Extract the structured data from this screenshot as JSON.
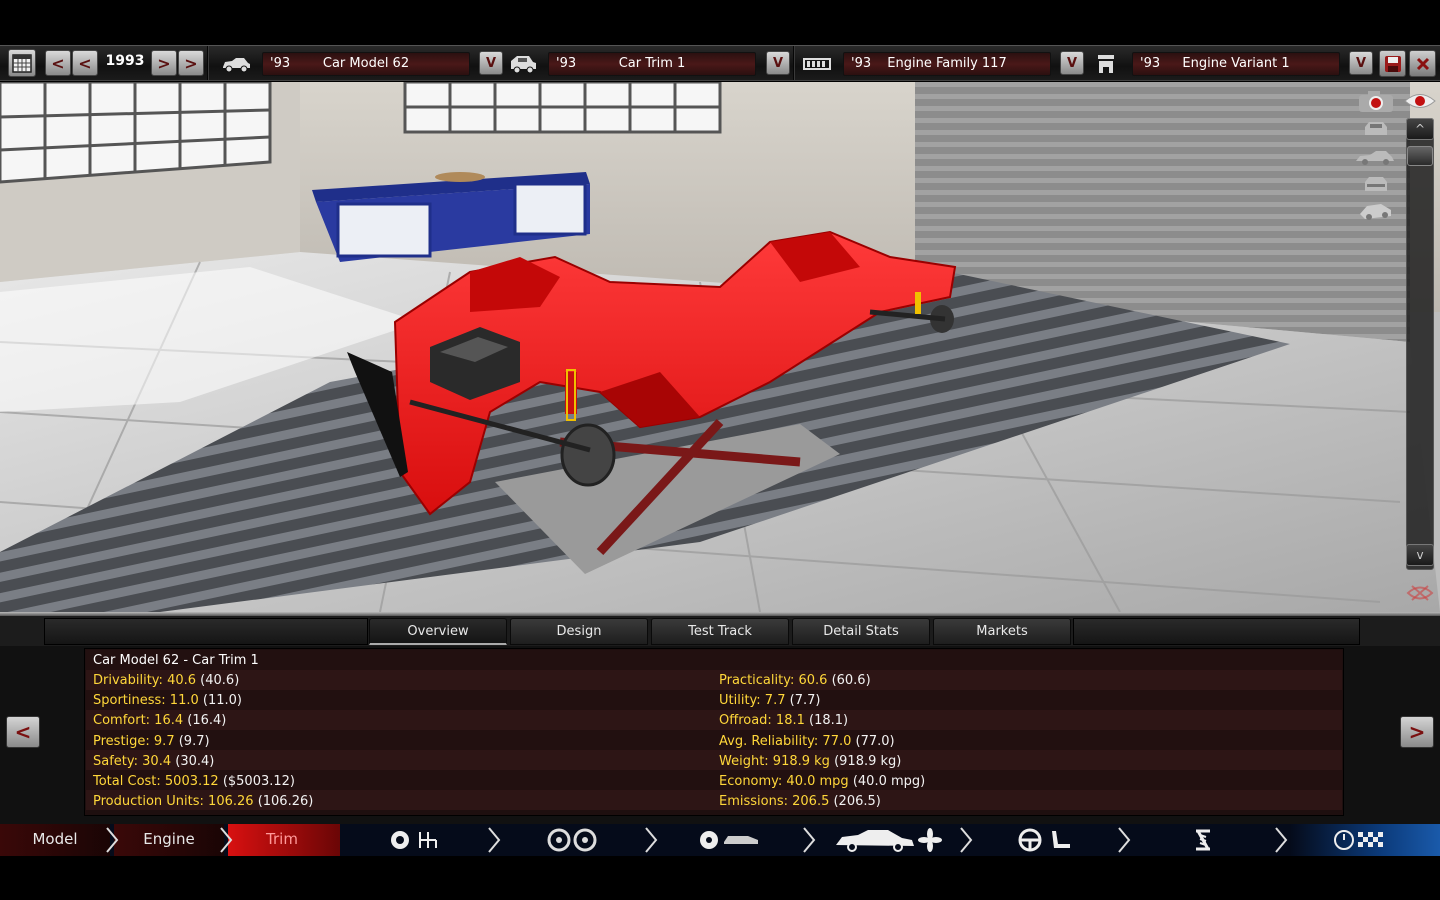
{
  "topbar": {
    "year": "1993",
    "prev_label": "<",
    "next_label": ">",
    "car_model": {
      "year": "'93",
      "name": "Car Model 62"
    },
    "car_trim": {
      "year": "'93",
      "name": "Car Trim 1"
    },
    "engine_family": {
      "year": "'93",
      "name": "Engine Family 117"
    },
    "engine_variant": {
      "year": "'93",
      "name": "Engine Variant 1"
    },
    "dropdown_label": "V"
  },
  "viewport": {
    "scroll_up": "^",
    "scroll_down": "v"
  },
  "tabs": [
    "Overview",
    "Design",
    "Test Track",
    "Detail Stats",
    "Markets"
  ],
  "active_tab": "Overview",
  "stats": {
    "title": "Car Model 62 - Car Trim 1",
    "left": [
      {
        "label": "Drivability: 40.6",
        "paren": "(40.6)"
      },
      {
        "label": "Sportiness: 11.0",
        "paren": "(11.0)"
      },
      {
        "label": "Comfort: 16.4",
        "paren": "(16.4)"
      },
      {
        "label": "Prestige: 9.7",
        "paren": "(9.7)"
      },
      {
        "label": "Safety: 30.4",
        "paren": "(30.4)"
      },
      {
        "label": "Total Cost: 5003.12",
        "paren": "($5003.12)"
      },
      {
        "label": "Production Units: 106.26",
        "paren": "(106.26)"
      }
    ],
    "right": [
      {
        "label": "Practicality: 60.6",
        "paren": "(60.6)"
      },
      {
        "label": "Utility: 7.7",
        "paren": "(7.7)"
      },
      {
        "label": "Offroad: 18.1",
        "paren": "(18.1)"
      },
      {
        "label": "Avg. Reliability: 77.0",
        "paren": "(77.0)"
      },
      {
        "label": "Weight: 918.9 kg",
        "paren": "(918.9 kg)"
      },
      {
        "label": "Economy: 40.0 mpg",
        "paren": "(40.0 mpg)"
      },
      {
        "label": "Emissions: 206.5",
        "paren": "(206.5)"
      }
    ]
  },
  "side_buttons": {
    "left": "<",
    "right": ">"
  },
  "nav": {
    "model": "Model",
    "engine": "Engine",
    "trim": "Trim",
    "active": "Trim"
  },
  "colors": {
    "stat_label": "#ffd73a",
    "car_body": "#ee1a1a",
    "selector_bg": "#4a1818",
    "nav_bg": "#050b1a"
  },
  "icons": [
    "calendar-icon",
    "car-model-icon",
    "car-trim-icon",
    "engine-family-icon",
    "engine-variant-icon",
    "save-icon",
    "close-icon",
    "camera-icon",
    "eye-icon",
    "gearbox-icon",
    "wheels-icon",
    "body-icon",
    "fixtures-icon",
    "interior-icon",
    "suspension-icon",
    "test-icon"
  ]
}
